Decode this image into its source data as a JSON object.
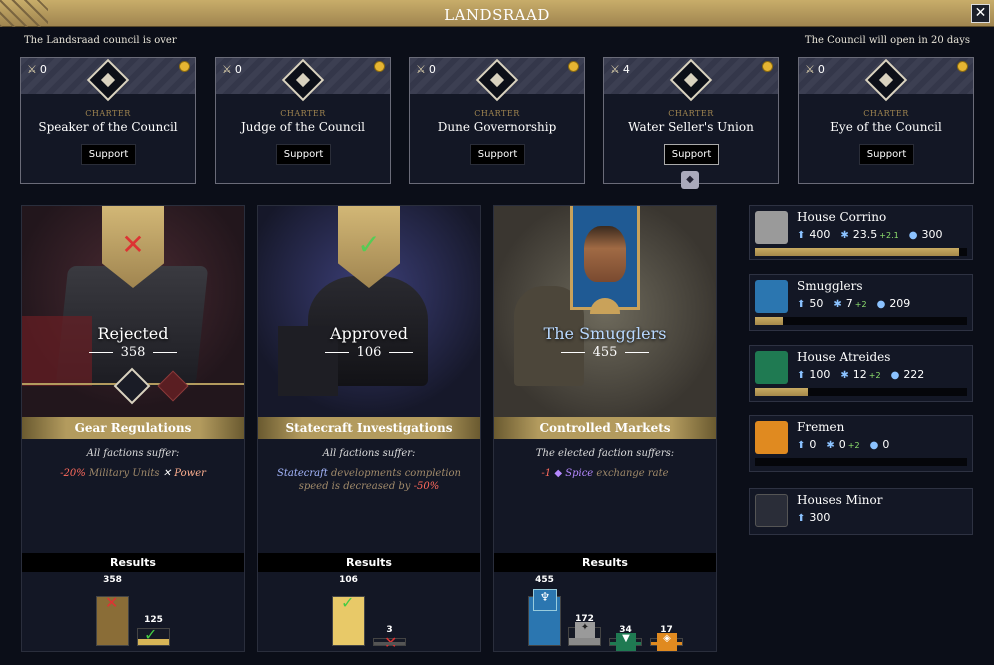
{
  "header": {
    "title": "LANDSRAAD",
    "close": "✕"
  },
  "status": {
    "left": "The Landsraad council is over",
    "right": "The Council will open in 20 days"
  },
  "charters": [
    {
      "count": "0",
      "label": "CHARTER",
      "name": "Speaker of the Council",
      "button": "Support"
    },
    {
      "count": "0",
      "label": "CHARTER",
      "name": "Judge of the Council",
      "button": "Support"
    },
    {
      "count": "0",
      "label": "CHARTER",
      "name": "Dune Governorship",
      "button": "Support"
    },
    {
      "count": "4",
      "label": "CHARTER",
      "name": "Water Seller's Union",
      "button": "Support"
    },
    {
      "count": "0",
      "label": "CHARTER",
      "name": "Eye of the Council",
      "button": "Support"
    }
  ],
  "decrees": [
    {
      "outcome": "Rejected",
      "votes": "358",
      "name": "Gear Regulations",
      "subtitle": "All factions suffer:",
      "effect": {
        "value": "-20%",
        "text": " Military Units ",
        "icon": "✕",
        "tail": " Power"
      },
      "results_label": "Results",
      "results": [
        {
          "value": "358",
          "fraction": 1.0,
          "color": "#8a6d37"
        },
        {
          "value": "125",
          "fraction": 0.35,
          "color": "#d7b557"
        }
      ]
    },
    {
      "outcome": "Approved",
      "votes": "106",
      "name": "Statecraft Investigations",
      "subtitle": "All factions suffer:",
      "effect": {
        "key": "Statecraft",
        "text": " developments completion speed is decreased by ",
        "value": "-50%"
      },
      "results_label": "Results",
      "results": [
        {
          "value": "106",
          "fraction": 1.0,
          "color": "#e8c968"
        },
        {
          "value": "3",
          "fraction": 0.03,
          "color": "#555"
        }
      ]
    },
    {
      "outcome": "The Smugglers",
      "votes": "455",
      "name": "Controlled Markets",
      "subtitle": "The elected faction suffers:",
      "effect": {
        "value": "-1",
        "key": "Spice",
        "text": " exchange rate"
      },
      "results_label": "Results",
      "results": [
        {
          "value": "455",
          "fraction": 1.0,
          "color": "#2b76b0"
        },
        {
          "value": "172",
          "fraction": 0.38,
          "color": "#8a8a8a"
        },
        {
          "value": "34",
          "fraction": 0.07,
          "color": "#1f7a52"
        },
        {
          "value": "17",
          "fraction": 0.04,
          "color": "#e08a20"
        }
      ]
    }
  ],
  "factions": [
    {
      "name": "House Corrino",
      "a": "400",
      "b": "23.5",
      "b_gain": "+2.1",
      "c": "300",
      "progress": 0.96,
      "color": "#9a9a9a"
    },
    {
      "name": "Smugglers",
      "a": "50",
      "b": "7",
      "b_gain": "+2",
      "c": "209",
      "progress": 0.13,
      "color": "#2b76b0"
    },
    {
      "name": "House Atreides",
      "a": "100",
      "b": "12",
      "b_gain": "+2",
      "c": "222",
      "progress": 0.25,
      "color": "#1f7a52"
    },
    {
      "name": "Fremen",
      "a": "0",
      "b": "0",
      "b_gain": "+2",
      "c": "0",
      "progress": 0.0,
      "color": "#e08a20"
    },
    {
      "name": "Houses Minor",
      "a": "300",
      "color": "#2a2d38"
    }
  ],
  "colors": {
    "gold": "#b39b5e",
    "panel": "#131725",
    "background": "#0b0e18",
    "negative": "#ff6a5c",
    "positive": "#8fe36f",
    "spice": "#b488ff"
  }
}
